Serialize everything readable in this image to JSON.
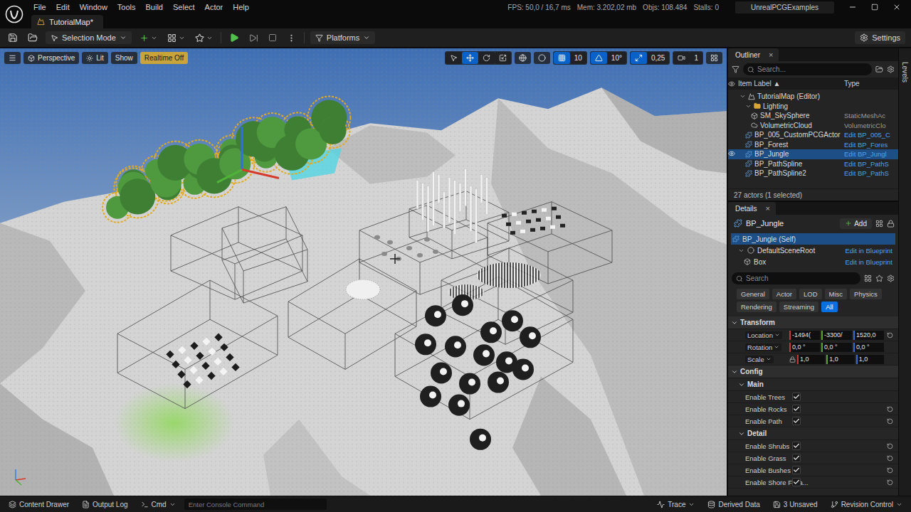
{
  "title_bar": {
    "menus": [
      "File",
      "Edit",
      "Window",
      "Tools",
      "Build",
      "Select",
      "Actor",
      "Help"
    ],
    "stats": [
      "FPS: 50,0 / 16,7 ms",
      "Mem: 3.202,02 mb",
      "Objs: 108.484",
      "Stalls: 0"
    ],
    "project": "UnrealPCGExamples"
  },
  "document_tab": {
    "label": "TutorialMap*",
    "selected": true
  },
  "toolbar": {
    "mode": "Selection Mode",
    "platforms": "Platforms",
    "settings": "Settings"
  },
  "viewport": {
    "view_buttons": [
      {
        "label": "Perspective",
        "kind": "perspective",
        "warning": false
      },
      {
        "label": "Lit",
        "kind": "lit",
        "warning": false
      },
      {
        "label": "Show",
        "kind": "plain",
        "warning": false
      },
      {
        "label": "Realtime Off",
        "kind": "plain",
        "warning": true
      }
    ],
    "transform_tools": [
      {
        "kind": "select",
        "selected": false
      },
      {
        "kind": "move",
        "selected": true
      },
      {
        "kind": "rotate",
        "selected": false
      },
      {
        "kind": "scale",
        "selected": false
      }
    ],
    "snaps": [
      {
        "label": "10",
        "kind": "grid",
        "active": true
      },
      {
        "label": "10°",
        "kind": "angle",
        "active": true
      },
      {
        "label": "0,25",
        "kind": "scale",
        "active": true
      },
      {
        "label": "1",
        "kind": "camera",
        "active": false
      }
    ]
  },
  "outliner": {
    "title": "Outliner",
    "close": "×",
    "search_placeholder": "Search...",
    "columns": [
      "Item Label",
      "Type"
    ],
    "sort": "▲",
    "rows": [
      {
        "label": "TutorialMap (Editor)",
        "type": "",
        "depth": 0,
        "kind": "map",
        "selected": false,
        "eye": false,
        "link": false,
        "expanded": true
      },
      {
        "label": "Lighting",
        "type": "",
        "depth": 1,
        "kind": "folder",
        "selected": false,
        "eye": false,
        "link": false,
        "expanded": true
      },
      {
        "label": "SM_SkySphere",
        "type": "StaticMeshAc",
        "depth": 2,
        "kind": "mesh",
        "selected": false,
        "eye": false,
        "link": false
      },
      {
        "label": "VolumetricCloud",
        "type": "VolumetricClo",
        "depth": 2,
        "kind": "cloud",
        "selected": false,
        "eye": false,
        "link": false
      },
      {
        "label": "BP_005_CustomPCGActor",
        "type": "Edit BP_005_C",
        "depth": 1,
        "kind": "blueprint",
        "selected": false,
        "eye": false,
        "link": true
      },
      {
        "label": "BP_Forest",
        "type": "Edit BP_Fores",
        "depth": 1,
        "kind": "blueprint",
        "selected": false,
        "eye": false,
        "link": true
      },
      {
        "label": "BP_Jungle",
        "type": "Edit BP_Jungl",
        "depth": 1,
        "kind": "blueprint",
        "selected": true,
        "eye": true,
        "link": true
      },
      {
        "label": "BP_PathSpline",
        "type": "Edit BP_PathS",
        "depth": 1,
        "kind": "blueprint",
        "selected": false,
        "eye": false,
        "link": true
      },
      {
        "label": "BP_PathSpline2",
        "type": "Edit BP_PathS",
        "depth": 1,
        "kind": "blueprint",
        "selected": false,
        "eye": false,
        "link": true
      }
    ],
    "footer": "27 actors (1 selected)"
  },
  "levels_tab": "Levels",
  "details": {
    "title": "Details",
    "close": "×",
    "actor": "BP_Jungle",
    "add": "Add",
    "components": [
      {
        "name": "BP_Jungle (Self)",
        "link": "",
        "depth": 0,
        "selected": true
      },
      {
        "name": "DefaultSceneRoot",
        "link": "Edit in Blueprint",
        "depth": 1,
        "selected": false
      },
      {
        "name": "Box",
        "link": "Edit in Blueprint",
        "depth": 2,
        "selected": false
      }
    ],
    "search_placeholder": "Search",
    "filters": [
      {
        "label": "General",
        "selected": false
      },
      {
        "label": "Actor",
        "selected": false
      },
      {
        "label": "LOD",
        "selected": false
      },
      {
        "label": "Misc",
        "selected": false
      },
      {
        "label": "Physics",
        "selected": false
      },
      {
        "label": "Rendering",
        "selected": false
      },
      {
        "label": "Streaming",
        "selected": false
      },
      {
        "label": "All",
        "selected": true
      }
    ],
    "transform": {
      "title": "Transform",
      "expanded": true,
      "rows": [
        {
          "label": "Location",
          "dropdown": true,
          "lock": false,
          "modified": true,
          "values": [
            {
              "text": "-1494(",
              "color": "#c8373a"
            },
            {
              "text": "-3300/",
              "color": "#5aa532"
            },
            {
              "text": "1520,0",
              "color": "#2f6fd6"
            }
          ]
        },
        {
          "label": "Rotation",
          "dropdown": true,
          "lock": false,
          "modified": false,
          "values": [
            {
              "text": "0,0 °",
              "color": "#c8373a"
            },
            {
              "text": "0,0 °",
              "color": "#5aa532"
            },
            {
              "text": "0,0 °",
              "color": "#2f6fd6"
            }
          ]
        },
        {
          "label": "Scale",
          "dropdown": true,
          "lock": true,
          "modified": false,
          "values": [
            {
              "text": "1,0",
              "color": "#c8373a"
            },
            {
              "text": "1,0",
              "color": "#5aa532"
            },
            {
              "text": "1,0",
              "color": "#2f6fd6"
            }
          ]
        }
      ]
    },
    "config": {
      "title": "Config",
      "expanded": true,
      "groups": [
        {
          "title": "Main",
          "expanded": true,
          "rows": [
            {
              "label": "Enable Trees",
              "checked": true,
              "modified": false
            },
            {
              "label": "Enable Rocks",
              "checked": true,
              "modified": true
            },
            {
              "label": "Enable Path",
              "checked": true,
              "modified": true
            }
          ]
        },
        {
          "title": "Detail",
          "expanded": true,
          "rows": [
            {
              "label": "Enable Shrubs",
              "checked": true,
              "modified": true
            },
            {
              "label": "Enable Grass",
              "checked": true,
              "modified": true
            },
            {
              "label": "Enable Bushes",
              "checked": true,
              "modified": true
            },
            {
              "label": "Enable Shore Folia...",
              "checked": true,
              "modified": true
            }
          ]
        }
      ]
    }
  },
  "status_bar": {
    "left": [
      {
        "label": "Content Drawer",
        "kind": "drawer"
      },
      {
        "label": "Output Log",
        "kind": "log"
      },
      {
        "label": "Cmd",
        "kind": "cmd"
      }
    ],
    "console_placeholder": "Enter Console Command",
    "right": [
      {
        "label": "Trace",
        "kind": "trace"
      },
      {
        "label": "Derived Data",
        "kind": "data"
      },
      {
        "label": "3 Unsaved",
        "kind": "unsaved"
      },
      {
        "label": "Revision Control",
        "kind": "revision"
      }
    ]
  }
}
